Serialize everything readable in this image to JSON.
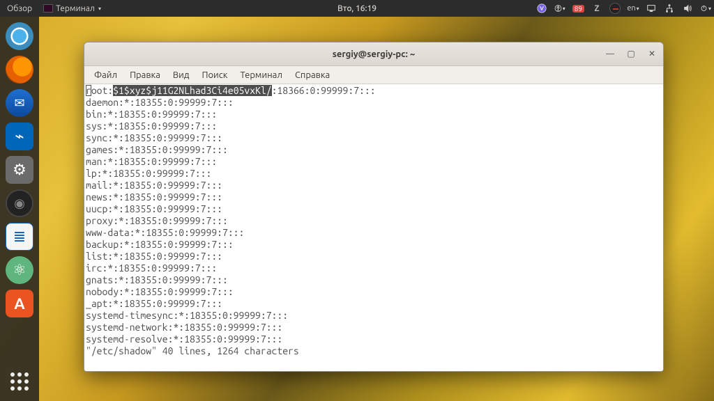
{
  "panel": {
    "overview": "Обзор",
    "app_menu": "Терминал",
    "clock": "Вто, 16:19",
    "badge_count": "89",
    "lang": "en"
  },
  "window": {
    "title": "sergiy@sergiy-pc: ~",
    "menus": [
      "Файл",
      "Правка",
      "Вид",
      "Поиск",
      "Терминал",
      "Справка"
    ]
  },
  "terminal": {
    "line0_a": "r",
    "line0_b": "oot:",
    "line0_hl": "$1$xyz$j11G2NLhad3Ci4e05vxKl/",
    "line0_c": ":18366:0:99999:7:::",
    "lines": [
      "daemon:*:18355:0:99999:7:::",
      "bin:*:18355:0:99999:7:::",
      "sys:*:18355:0:99999:7:::",
      "sync:*:18355:0:99999:7:::",
      "games:*:18355:0:99999:7:::",
      "man:*:18355:0:99999:7:::",
      "lp:*:18355:0:99999:7:::",
      "mail:*:18355:0:99999:7:::",
      "news:*:18355:0:99999:7:::",
      "uucp:*:18355:0:99999:7:::",
      "proxy:*:18355:0:99999:7:::",
      "www-data:*:18355:0:99999:7:::",
      "backup:*:18355:0:99999:7:::",
      "list:*:18355:0:99999:7:::",
      "irc:*:18355:0:99999:7:::",
      "gnats:*:18355:0:99999:7:::",
      "nobody:*:18355:0:99999:7:::",
      "_apt:*:18355:0:99999:7:::",
      "systemd-timesync:*:18355:0:99999:7:::",
      "systemd-network:*:18355:0:99999:7:::",
      "systemd-resolve:*:18355:0:99999:7:::"
    ],
    "status": "\"/etc/shadow\" 40 lines, 1264 characters"
  }
}
